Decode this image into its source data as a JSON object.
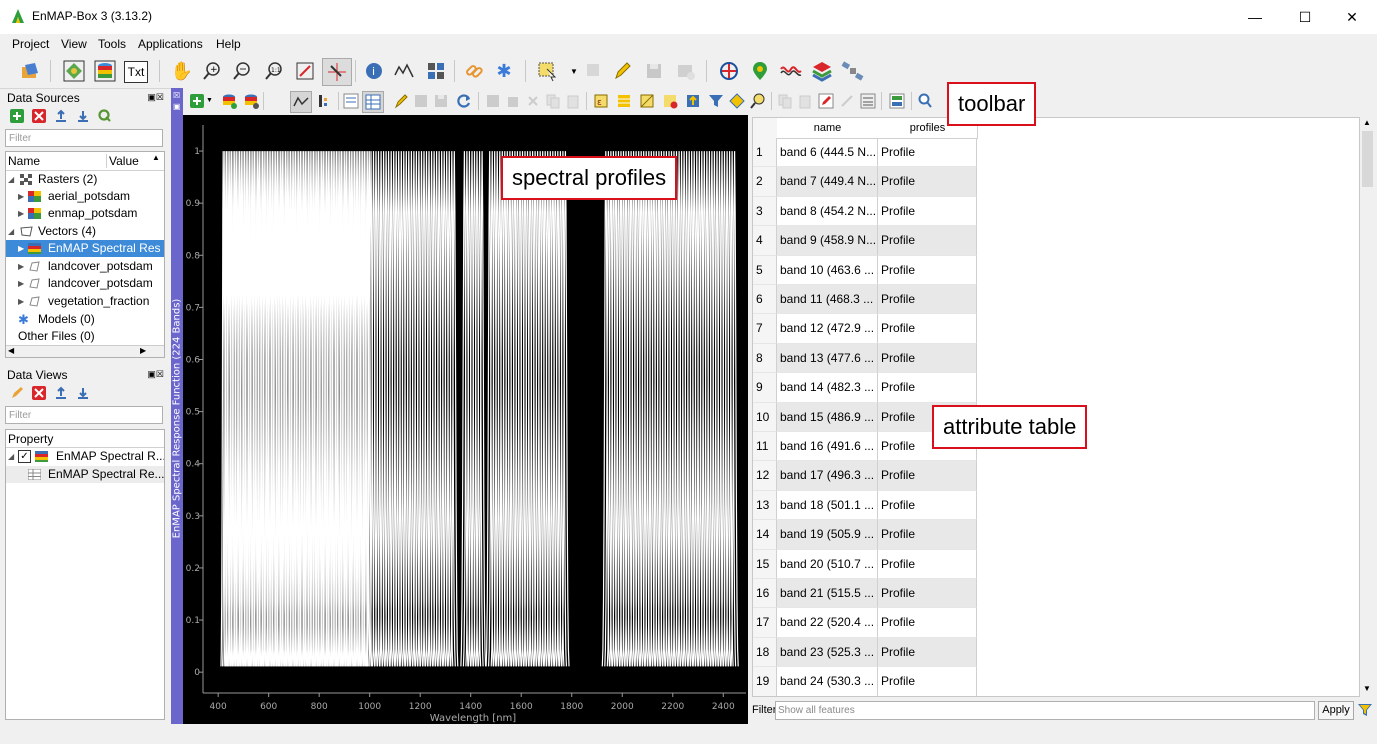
{
  "window": {
    "title": "EnMAP-Box 3 (3.13.2)",
    "minimize": "—",
    "maximize": "☐",
    "close": "✕"
  },
  "menu": [
    "Project",
    "View",
    "Tools",
    "Applications",
    "Help"
  ],
  "main_toolbar": {
    "txt_button": "Txt"
  },
  "data_sources": {
    "title": "Data Sources",
    "filter_placeholder": "Filter",
    "columns": [
      "Name",
      "Value"
    ],
    "items": [
      {
        "label": "Rasters (2)",
        "icon": "raster-group-icon"
      },
      {
        "label": "aerial_potsdam",
        "icon": "raster-icon"
      },
      {
        "label": "enmap_potsdam",
        "icon": "raster-icon"
      },
      {
        "label": "Vectors (4)",
        "icon": "vector-group-icon"
      },
      {
        "label": "EnMAP Spectral Res",
        "icon": "spectral-library-icon"
      },
      {
        "label": "landcover_potsdam",
        "icon": "polygon-layer-icon"
      },
      {
        "label": "landcover_potsdam",
        "icon": "polygon-layer-icon"
      },
      {
        "label": "vegetation_fraction",
        "icon": "polygon-layer-icon"
      },
      {
        "label": "Models (0)",
        "icon": "model-icon"
      },
      {
        "label": "Other Files (0)",
        "icon": ""
      }
    ]
  },
  "data_views": {
    "title": "Data Views",
    "filter_placeholder": "Filter",
    "column": "Property",
    "items": [
      {
        "label": "EnMAP Spectral R..."
      },
      {
        "label": "EnMAP Spectral Re..."
      }
    ]
  },
  "plot": {
    "ylabel": "EnMAP Spectral Response Function (224 Bands)",
    "xlabel": "Wavelength [nm]",
    "xticks": [
      "400",
      "600",
      "800",
      "1000",
      "1200",
      "1400",
      "1600",
      "1800",
      "2000",
      "2200",
      "2400"
    ],
    "yticks": [
      "0",
      "0.1",
      "0.2",
      "0.3",
      "0.4",
      "0.5",
      "0.6",
      "0.7",
      "0.8",
      "0.9",
      "1"
    ],
    "xlim": [
      340,
      2490
    ],
    "ylim": [
      -0.04,
      1.05
    ],
    "gaps_nm": [
      [
        1340,
        1370
      ],
      [
        1450,
        1470
      ],
      [
        1785,
        1930
      ]
    ],
    "line_color": "#ffffff",
    "background": "#000000"
  },
  "attribute_table": {
    "columns": [
      "name",
      "profiles"
    ],
    "rows": [
      [
        "1",
        "band 6 (444.5 N...",
        "Profile"
      ],
      [
        "2",
        "band 7 (449.4 N...",
        "Profile"
      ],
      [
        "3",
        "band 8 (454.2 N...",
        "Profile"
      ],
      [
        "4",
        "band 9 (458.9 N...",
        "Profile"
      ],
      [
        "5",
        "band 10 (463.6 ...",
        "Profile"
      ],
      [
        "6",
        "band 11 (468.3 ...",
        "Profile"
      ],
      [
        "7",
        "band 12 (472.9 ...",
        "Profile"
      ],
      [
        "8",
        "band 13 (477.6 ...",
        "Profile"
      ],
      [
        "9",
        "band 14 (482.3 ...",
        "Profile"
      ],
      [
        "10",
        "band 15 (486.9 ...",
        "Profile"
      ],
      [
        "11",
        "band 16 (491.6 ...",
        "Profile"
      ],
      [
        "12",
        "band 17 (496.3 ...",
        "Profile"
      ],
      [
        "13",
        "band 18 (501.1 ...",
        "Profile"
      ],
      [
        "14",
        "band 19 (505.9 ...",
        "Profile"
      ],
      [
        "15",
        "band 20 (510.7 ...",
        "Profile"
      ],
      [
        "16",
        "band 21 (515.5 ...",
        "Profile"
      ],
      [
        "17",
        "band 22 (520.4 ...",
        "Profile"
      ],
      [
        "18",
        "band 23 (525.3 ...",
        "Profile"
      ],
      [
        "19",
        "band 24 (530.3 ..."
      ]
    ],
    "last_row_profile": "Profile",
    "filter_label": "Filter",
    "filter_placeholder": "Show all features",
    "apply_label": "Apply"
  },
  "annotations": {
    "toolbar": "toolbar",
    "spectral_profiles": "spectral profiles",
    "attribute_table": "attribute table"
  },
  "colors": {
    "annotation_border": "#d9101b",
    "view_background": "#6b66cc",
    "selection": "#3d8bd8"
  }
}
